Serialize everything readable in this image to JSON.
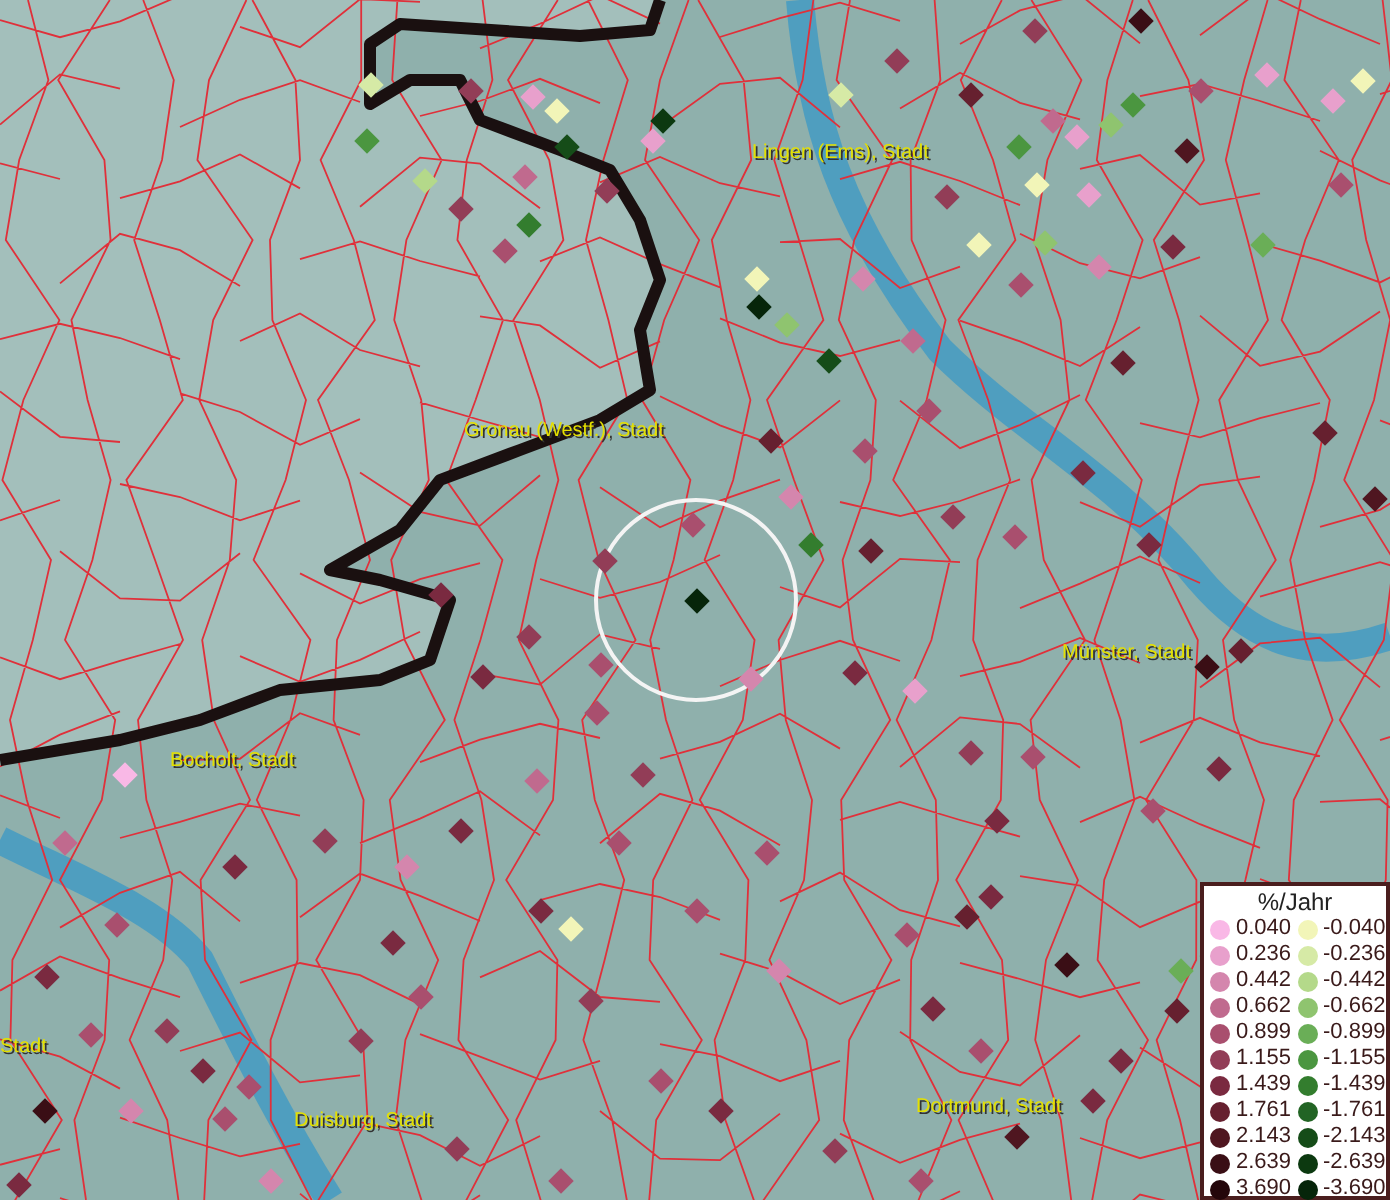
{
  "map": {
    "place_labels": [
      {
        "text": "Lingen (Ems), Stadt"
      },
      {
        "text": "Gronau (Westf.), Stadt"
      },
      {
        "text": "Münster, Stadt"
      },
      {
        "text": "Bocholt, Stadt"
      },
      {
        "text": "Stadt"
      },
      {
        "text": "Dortmund, Stadt"
      },
      {
        "text": "Duisburg, Stadt"
      }
    ],
    "markers": [
      {
        "color": "#d6eaa6"
      },
      {
        "color": "#923d57"
      },
      {
        "color": "#e8a0cc"
      },
      {
        "color": "#f2f5b8"
      },
      {
        "color": "#0c3910"
      },
      {
        "color": "#e8a0cc"
      },
      {
        "color": "#4b9640"
      },
      {
        "color": "#b4d98a"
      },
      {
        "color": "#154c18"
      },
      {
        "color": "#c06a8e"
      },
      {
        "color": "#923d57"
      },
      {
        "color": "#337d2e"
      },
      {
        "color": "#923d57"
      },
      {
        "color": "#a94f6e"
      },
      {
        "color": "#66202f"
      },
      {
        "color": "#923d57"
      },
      {
        "color": "#3a0e15"
      },
      {
        "color": "#a94f6e"
      },
      {
        "color": "#e8a0cc"
      },
      {
        "color": "#f2f5b8"
      },
      {
        "color": "#e8a0cc"
      },
      {
        "color": "#d6eaa6"
      },
      {
        "color": "#923d57"
      },
      {
        "color": "#4b9640"
      },
      {
        "color": "#c06a8e"
      },
      {
        "color": "#e8a0cc"
      },
      {
        "color": "#8fc46f"
      },
      {
        "color": "#4b9640"
      },
      {
        "color": "#4f1620"
      },
      {
        "color": "#e8a0cc"
      },
      {
        "color": "#f2f5b8"
      },
      {
        "color": "#923d57"
      },
      {
        "color": "#f2f5b8"
      },
      {
        "color": "#8fc46f"
      },
      {
        "color": "#d486ad"
      },
      {
        "color": "#7a2a40"
      },
      {
        "color": "#6aae57"
      },
      {
        "color": "#a94f6e"
      },
      {
        "color": "#f2f5b8"
      },
      {
        "color": "#06250a"
      },
      {
        "color": "#8fc46f"
      },
      {
        "color": "#154c18"
      },
      {
        "color": "#d486ad"
      },
      {
        "color": "#c06a8e"
      },
      {
        "color": "#a94f6e"
      },
      {
        "color": "#66202f"
      },
      {
        "color": "#a94f6e"
      },
      {
        "color": "#66202f"
      },
      {
        "color": "#a94f6e"
      },
      {
        "color": "#d486ad"
      },
      {
        "color": "#337d2e"
      },
      {
        "color": "#a94f6e"
      },
      {
        "color": "#06250a"
      },
      {
        "color": "#923d57"
      },
      {
        "color": "#66202f"
      },
      {
        "color": "#923d57"
      },
      {
        "color": "#a94f6e"
      },
      {
        "color": "#7a2a40"
      },
      {
        "color": "#7a2a40"
      },
      {
        "color": "#66202f"
      },
      {
        "color": "#4f1620"
      },
      {
        "color": "#7a2a40"
      },
      {
        "color": "#923d57"
      },
      {
        "color": "#7a2a40"
      },
      {
        "color": "#a94f6e"
      },
      {
        "color": "#d486ad"
      },
      {
        "color": "#e8a0cc"
      },
      {
        "color": "#923d57"
      },
      {
        "color": "#a94f6e"
      },
      {
        "color": "#7a2a40"
      },
      {
        "color": "#a94f6e"
      },
      {
        "color": "#7a2a40"
      },
      {
        "color": "#66202f"
      },
      {
        "color": "#3a0e15"
      },
      {
        "color": "#7a2a40"
      },
      {
        "color": "#a94f6e"
      },
      {
        "color": "#923d57"
      },
      {
        "color": "#c06a8e"
      },
      {
        "color": "#7a2a40"
      },
      {
        "color": "#d486ad"
      },
      {
        "color": "#923d57"
      },
      {
        "color": "#f9b8e6"
      },
      {
        "color": "#7a2a40"
      },
      {
        "color": "#c06a8e"
      },
      {
        "color": "#a94f6e"
      },
      {
        "color": "#7a2a40"
      },
      {
        "color": "#923d57"
      },
      {
        "color": "#a94f6e"
      },
      {
        "color": "#7a2a40"
      },
      {
        "color": "#a94f6e"
      },
      {
        "color": "#3a0e15"
      },
      {
        "color": "#d486ad"
      },
      {
        "color": "#a94f6e"
      },
      {
        "color": "#7a2a40"
      },
      {
        "color": "#d486ad"
      },
      {
        "color": "#a94f6e"
      },
      {
        "color": "#a94f6e"
      },
      {
        "color": "#7a2a40"
      },
      {
        "color": "#f2f5b8"
      },
      {
        "color": "#a94f6e"
      },
      {
        "color": "#d486ad"
      },
      {
        "color": "#923d57"
      },
      {
        "color": "#7a2a40"
      },
      {
        "color": "#a94f6e"
      },
      {
        "color": "#923d57"
      },
      {
        "color": "#a94f6e"
      },
      {
        "color": "#66202f"
      },
      {
        "color": "#7a2a40"
      },
      {
        "color": "#7a2a40"
      },
      {
        "color": "#3a0e15"
      },
      {
        "color": "#923d57"
      },
      {
        "color": "#a94f6e"
      },
      {
        "color": "#a94f6e"
      },
      {
        "color": "#7a2a40"
      },
      {
        "color": "#923d57"
      },
      {
        "color": "#4f1620"
      },
      {
        "color": "#7a2a40"
      },
      {
        "color": "#6aae57"
      },
      {
        "color": "#66202f"
      },
      {
        "color": "#7a2a40"
      },
      {
        "color": "#a94f6e"
      },
      {
        "color": "#a94f6e"
      }
    ]
  },
  "legend": {
    "title": "%/Jahr",
    "positive": [
      {
        "value": "0.040",
        "color": "#f9b8e6"
      },
      {
        "value": "0.236",
        "color": "#e8a0cc"
      },
      {
        "value": "0.442",
        "color": "#d486ad"
      },
      {
        "value": "0.662",
        "color": "#c06a8e"
      },
      {
        "value": "0.899",
        "color": "#a94f6e"
      },
      {
        "value": "1.155",
        "color": "#923d57"
      },
      {
        "value": "1.439",
        "color": "#7a2a40"
      },
      {
        "value": "1.761",
        "color": "#66202f"
      },
      {
        "value": "2.143",
        "color": "#4f1620"
      },
      {
        "value": "2.639",
        "color": "#3a0e15"
      },
      {
        "value": "3.690",
        "color": "#24060a"
      }
    ],
    "negative": [
      {
        "value": "-0.040",
        "color": "#f2f5b8"
      },
      {
        "value": "-0.236",
        "color": "#d6eaa6"
      },
      {
        "value": "-0.442",
        "color": "#b4d98a"
      },
      {
        "value": "-0.662",
        "color": "#8fc46f"
      },
      {
        "value": "-0.899",
        "color": "#6aae57"
      },
      {
        "value": "-1.155",
        "color": "#4b9640"
      },
      {
        "value": "-1.439",
        "color": "#337d2e"
      },
      {
        "value": "-1.761",
        "color": "#226424"
      },
      {
        "value": "-2.143",
        "color": "#154c18"
      },
      {
        "value": "-2.639",
        "color": "#0c3910"
      },
      {
        "value": "-3.690",
        "color": "#06250a"
      }
    ]
  }
}
